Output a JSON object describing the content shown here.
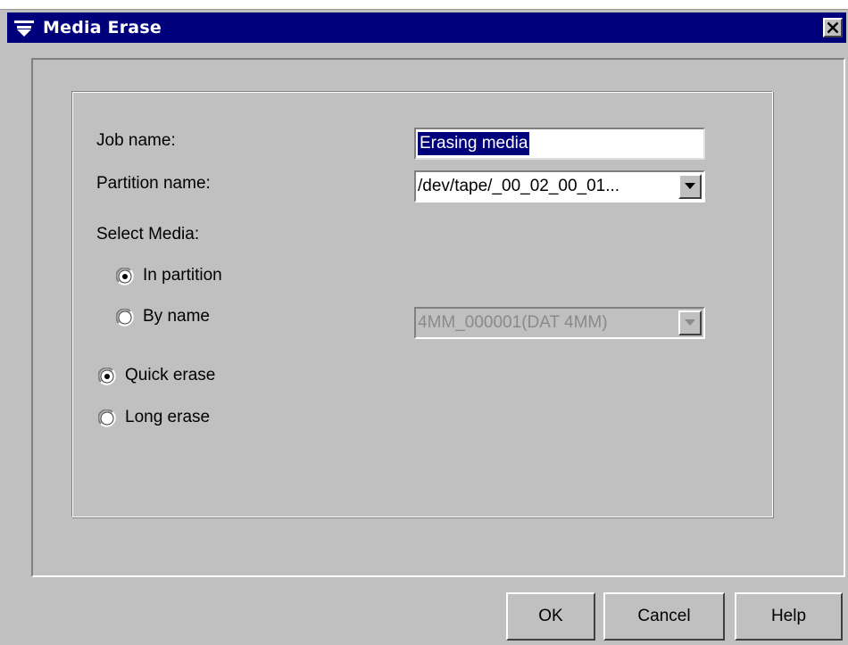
{
  "window": {
    "title": "Media Erase"
  },
  "form": {
    "job_name_label": "Job name:",
    "job_name_value": "Erasing media",
    "partition_name_label": "Partition name:",
    "partition_name_value": "/dev/tape/_00_02_00_01...",
    "select_media_label": "Select Media:",
    "in_partition_label": "In partition",
    "by_name_label": "By name",
    "by_name_value": "4MM_000001(DAT 4MM)",
    "quick_erase_label": "Quick erase",
    "long_erase_label": "Long erase",
    "select_media_choice": "In partition",
    "erase_choice": "Quick erase"
  },
  "buttons": {
    "ok_label": "OK",
    "cancel_label": "Cancel",
    "help_label": "Help"
  },
  "icons": {
    "title_menu": "window-menu-icon",
    "close": "close-icon",
    "dropdown": "dropdown-arrow-icon",
    "radio_selected": "radio-selected-icon",
    "radio_unselected": "radio-unselected-icon"
  }
}
